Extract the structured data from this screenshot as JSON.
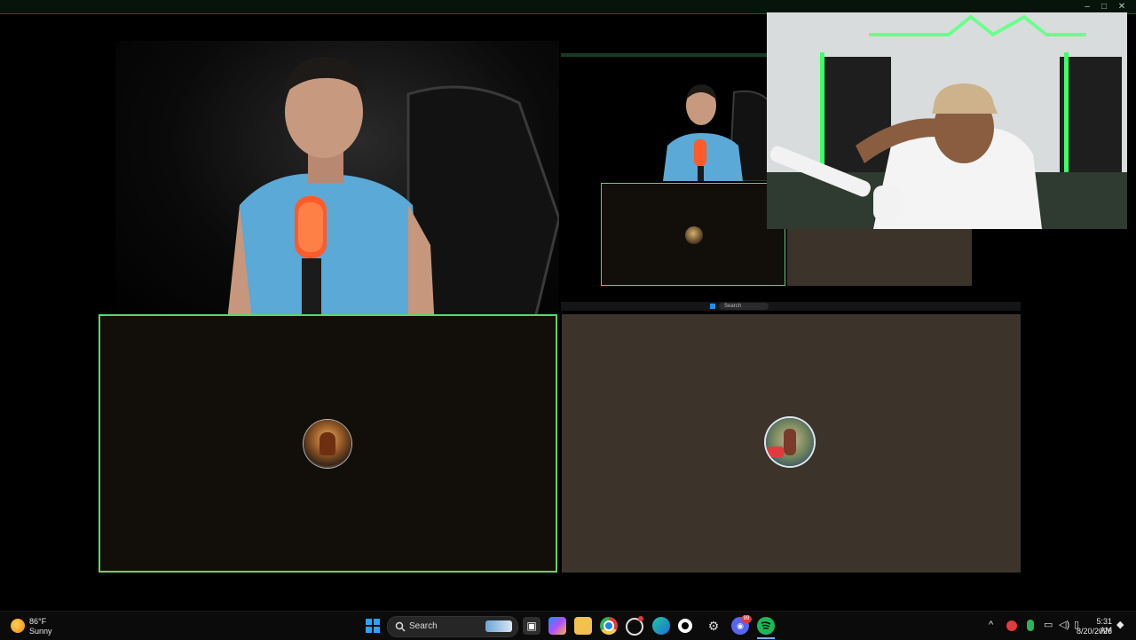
{
  "window": {
    "controls": [
      "–",
      "□",
      "✕"
    ]
  },
  "stage": {
    "top_right_window": {
      "taskbar_search": "Search"
    }
  },
  "weather": {
    "temp": "86°F",
    "condition": "Sunny"
  },
  "taskbar": {
    "search_label": "Search",
    "time": "5:31 AM",
    "date": "8/20/2026",
    "discord_badge": "99"
  },
  "colors": {
    "accent_green": "#5cd66b",
    "tile_dark": "#120f0b",
    "tile_brown": "#3c342b"
  },
  "icons": {
    "weather": "sun-icon",
    "start": "windows-start-icon",
    "search": "search-icon",
    "task_view": "task-view-icon",
    "copilot": "copilot-icon",
    "explorer": "folder-icon",
    "chrome": "chrome-icon",
    "edge": "edge-icon",
    "discord": "discord-icon",
    "spotify": "spotify-icon",
    "settings": "gear-icon",
    "obs": "obs-icon",
    "tray_chevron": "chevron-up-icon",
    "network": "wifi-icon",
    "volume": "volume-icon",
    "battery": "battery-icon"
  }
}
